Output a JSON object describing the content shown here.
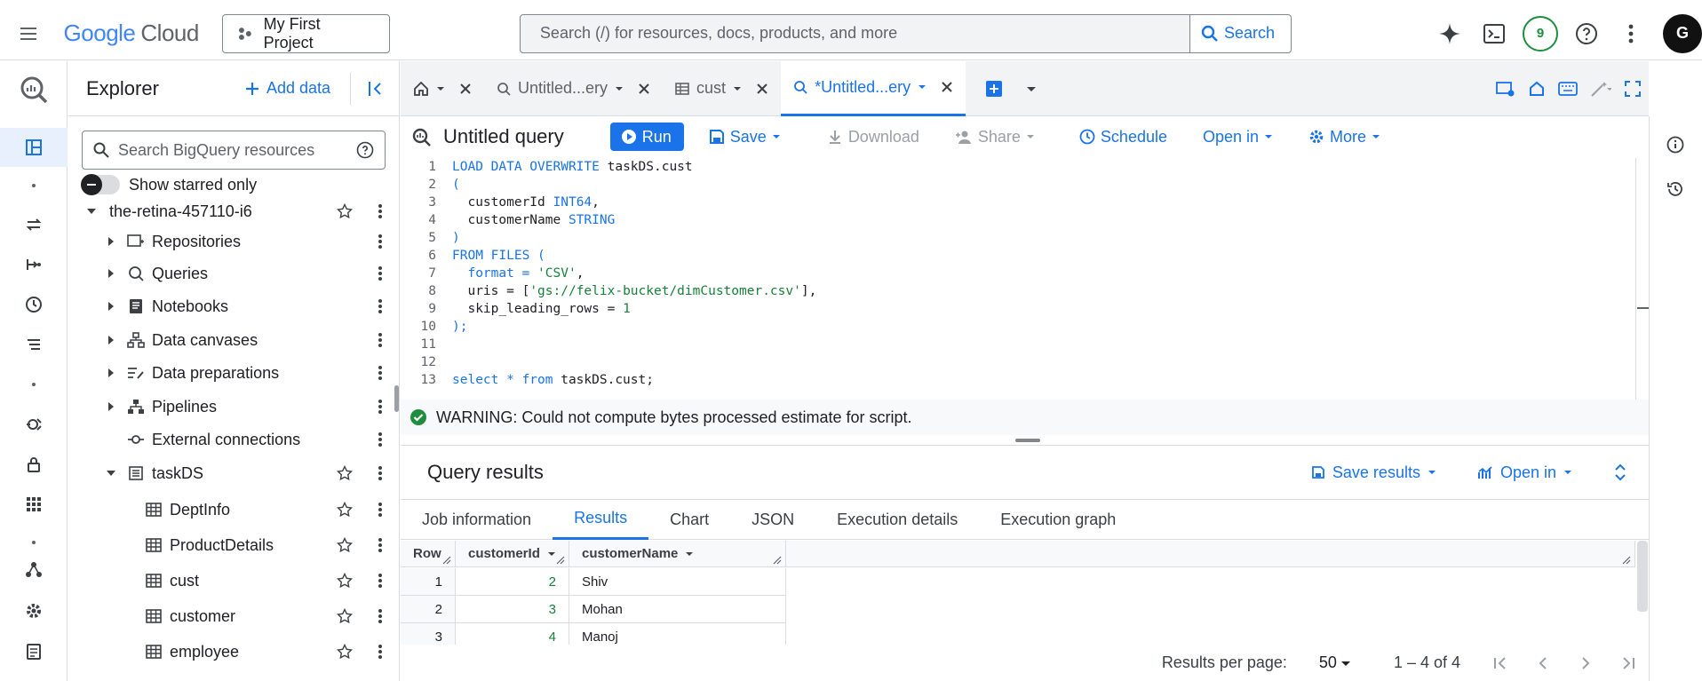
{
  "topbar": {
    "logo_google": "Google",
    "logo_cloud": "Cloud",
    "project_name": "My First Project",
    "search_placeholder": "Search (/) for resources, docs, products, and more",
    "search_button": "Search",
    "notifications_count": "9",
    "avatar_initial": "G"
  },
  "explorer": {
    "title": "Explorer",
    "add_data": "Add data",
    "search_placeholder": "Search BigQuery resources",
    "starred_label": "Show starred only",
    "tree": [
      {
        "label": "the-retina-457110-i6",
        "type": "project",
        "expanded": true
      },
      {
        "label": "Repositories",
        "type": "repositories"
      },
      {
        "label": "Queries",
        "type": "queries"
      },
      {
        "label": "Notebooks",
        "type": "notebooks"
      },
      {
        "label": "Data canvases",
        "type": "canvases"
      },
      {
        "label": "Data preparations",
        "type": "preparations"
      },
      {
        "label": "Pipelines",
        "type": "pipelines"
      },
      {
        "label": "External connections",
        "type": "connections"
      },
      {
        "label": "taskDS",
        "type": "dataset",
        "expanded": true
      },
      {
        "label": "DeptInfo",
        "type": "table"
      },
      {
        "label": "ProductDetails",
        "type": "table"
      },
      {
        "label": "cust",
        "type": "table"
      },
      {
        "label": "customer",
        "type": "table"
      },
      {
        "label": "employee",
        "type": "table"
      }
    ]
  },
  "tabs": [
    {
      "label": "",
      "icon": "home-icon"
    },
    {
      "label": "Untitled...ery",
      "icon": "query-icon"
    },
    {
      "label": "cust",
      "icon": "table-icon"
    },
    {
      "label": "*Untitled...ery",
      "icon": "query-icon",
      "active": true
    }
  ],
  "toolbar": {
    "title": "Untitled query",
    "run": "Run",
    "save": "Save",
    "download": "Download",
    "share": "Share",
    "schedule": "Schedule",
    "open_in": "Open in",
    "more": "More"
  },
  "editor": {
    "lines": [
      {
        "n": "1",
        "tokens": [
          {
            "t": "LOAD DATA OVERWRITE ",
            "c": "kw"
          },
          {
            "t": "taskDS.cust",
            "c": "plain"
          }
        ]
      },
      {
        "n": "2",
        "tokens": [
          {
            "t": "(",
            "c": "kw"
          }
        ]
      },
      {
        "n": "3",
        "tokens": [
          {
            "t": "  customerId ",
            "c": "plain"
          },
          {
            "t": "INT64",
            "c": "kw"
          },
          {
            "t": ",",
            "c": "plain"
          }
        ]
      },
      {
        "n": "4",
        "tokens": [
          {
            "t": "  customerName ",
            "c": "plain"
          },
          {
            "t": "STRING",
            "c": "kw"
          }
        ]
      },
      {
        "n": "5",
        "tokens": [
          {
            "t": ")",
            "c": "kw"
          }
        ]
      },
      {
        "n": "6",
        "tokens": [
          {
            "t": "FROM FILES (",
            "c": "kw"
          }
        ]
      },
      {
        "n": "7",
        "tokens": [
          {
            "t": "  format = ",
            "c": "kw"
          },
          {
            "t": "'CSV'",
            "c": "str"
          },
          {
            "t": ",",
            "c": "plain"
          }
        ]
      },
      {
        "n": "8",
        "tokens": [
          {
            "t": "  uris = [",
            "c": "plain"
          },
          {
            "t": "'gs://felix-bucket/dimCustomer.csv'",
            "c": "str"
          },
          {
            "t": "],",
            "c": "plain"
          }
        ]
      },
      {
        "n": "9",
        "tokens": [
          {
            "t": "  skip_leading_rows = ",
            "c": "plain"
          },
          {
            "t": "1",
            "c": "num"
          }
        ]
      },
      {
        "n": "10",
        "tokens": [
          {
            "t": ");",
            "c": "kw"
          }
        ]
      },
      {
        "n": "11",
        "tokens": []
      },
      {
        "n": "12",
        "tokens": []
      },
      {
        "n": "13",
        "tokens": [
          {
            "t": "select * from ",
            "c": "kw"
          },
          {
            "t": "taskDS.cust;",
            "c": "plain"
          }
        ]
      }
    ]
  },
  "warning": "WARNING: Could not compute bytes processed estimate for script.",
  "results": {
    "title": "Query results",
    "save_results": "Save results",
    "open_in": "Open in",
    "tabs": [
      "Job information",
      "Results",
      "Chart",
      "JSON",
      "Execution details",
      "Execution graph"
    ],
    "active_tab": "Results",
    "columns": [
      "Row",
      "customerId",
      "customerName"
    ],
    "rows": [
      [
        "1",
        "2",
        "Shiv"
      ],
      [
        "2",
        "3",
        "Mohan"
      ],
      [
        "3",
        "4",
        "Manoj"
      ]
    ],
    "rows_per_page_label": "Results per page:",
    "rows_per_page": "50",
    "range": "1 – 4 of 4"
  },
  "colors": {
    "accent": "#1a73e8",
    "success": "#1e8e3e"
  }
}
